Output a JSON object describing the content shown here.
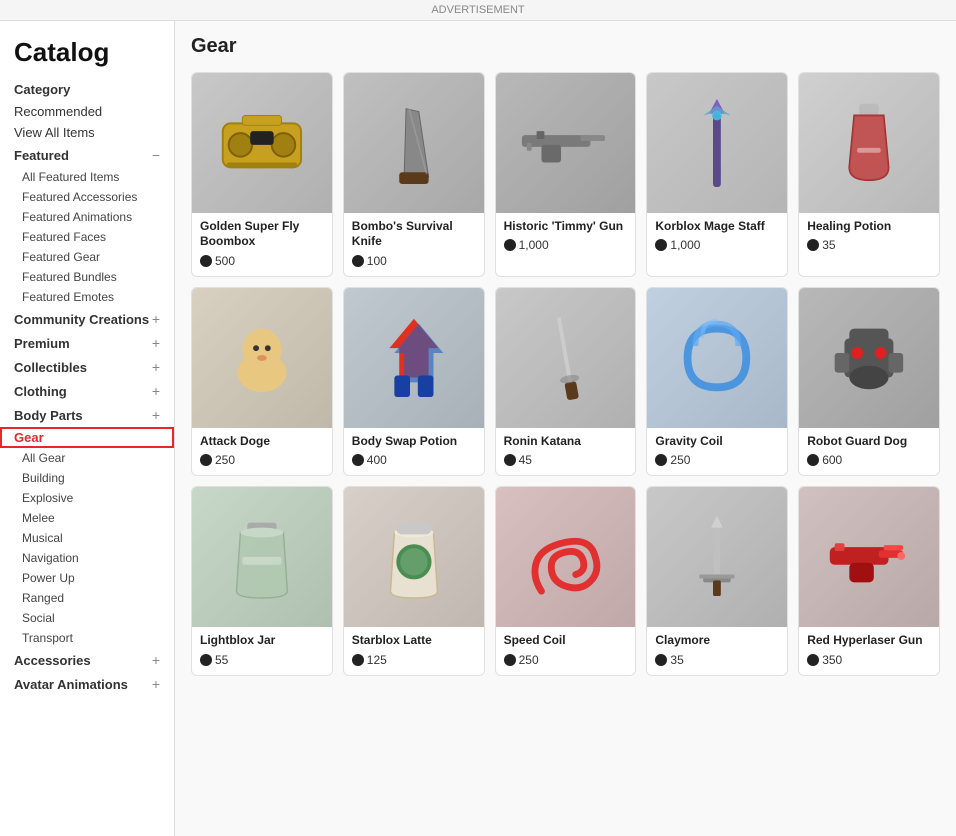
{
  "page": {
    "ad_label": "ADVERTISEMENT",
    "sidebar_title": "Catalog"
  },
  "sidebar": {
    "category_label": "Category",
    "items": [
      {
        "id": "recommended",
        "label": "Recommended",
        "level": "top",
        "active": false
      },
      {
        "id": "view-all",
        "label": "View All Items",
        "level": "top",
        "active": false
      },
      {
        "id": "featured",
        "label": "Featured",
        "level": "section",
        "toggle": "−"
      },
      {
        "id": "all-featured",
        "label": "All Featured Items",
        "level": "sub",
        "active": false
      },
      {
        "id": "featured-accessories",
        "label": "Featured Accessories",
        "level": "sub",
        "active": false
      },
      {
        "id": "featured-animations",
        "label": "Featured Animations",
        "level": "sub",
        "active": false
      },
      {
        "id": "featured-faces",
        "label": "Featured Faces",
        "level": "sub",
        "active": false
      },
      {
        "id": "featured-gear",
        "label": "Featured Gear",
        "level": "sub",
        "active": false
      },
      {
        "id": "featured-bundles",
        "label": "Featured Bundles",
        "level": "sub",
        "active": false
      },
      {
        "id": "featured-emotes",
        "label": "Featured Emotes",
        "level": "sub",
        "active": false
      },
      {
        "id": "community-creations",
        "label": "Community Creations",
        "level": "section",
        "toggle": "+"
      },
      {
        "id": "premium",
        "label": "Premium",
        "level": "top-toggle",
        "toggle": "+"
      },
      {
        "id": "collectibles",
        "label": "Collectibles",
        "level": "top-toggle",
        "toggle": "+"
      },
      {
        "id": "clothing",
        "label": "Clothing",
        "level": "top-toggle",
        "toggle": "+"
      },
      {
        "id": "body-parts",
        "label": "Body Parts",
        "level": "top-toggle",
        "toggle": "+"
      },
      {
        "id": "gear",
        "label": "Gear",
        "level": "top-toggle",
        "toggle": "",
        "active": true
      },
      {
        "id": "all-gear",
        "label": "All Gear",
        "level": "sub",
        "active": false
      },
      {
        "id": "building",
        "label": "Building",
        "level": "sub",
        "active": false
      },
      {
        "id": "explosive",
        "label": "Explosive",
        "level": "sub",
        "active": false
      },
      {
        "id": "melee",
        "label": "Melee",
        "level": "sub",
        "active": false
      },
      {
        "id": "musical",
        "label": "Musical",
        "level": "sub",
        "active": false
      },
      {
        "id": "navigation",
        "label": "Navigation",
        "level": "sub",
        "active": false
      },
      {
        "id": "power-up",
        "label": "Power Up",
        "level": "sub",
        "active": false
      },
      {
        "id": "ranged",
        "label": "Ranged",
        "level": "sub",
        "active": false
      },
      {
        "id": "social",
        "label": "Social",
        "level": "sub",
        "active": false
      },
      {
        "id": "transport",
        "label": "Transport",
        "level": "sub",
        "active": false
      },
      {
        "id": "accessories",
        "label": "Accessories",
        "level": "top-toggle",
        "toggle": "+"
      },
      {
        "id": "avatar-animations",
        "label": "Avatar Animations",
        "level": "top-toggle",
        "toggle": "+"
      }
    ]
  },
  "content": {
    "section_title": "Gear",
    "items": [
      {
        "id": 1,
        "name": "Golden Super Fly Boombox",
        "price": 500,
        "thumb_class": "thumb-boombox",
        "shape": "boombox"
      },
      {
        "id": 2,
        "name": "Bombo's Survival Knife",
        "price": 100,
        "thumb_class": "thumb-knife",
        "shape": "knife"
      },
      {
        "id": 3,
        "name": "Historic 'Timmy' Gun",
        "price": 1000,
        "thumb_class": "thumb-gun",
        "shape": "rifle"
      },
      {
        "id": 4,
        "name": "Korblox Mage Staff",
        "price": 1000,
        "thumb_class": "thumb-staff",
        "shape": "staff"
      },
      {
        "id": 5,
        "name": "Healing Potion",
        "price": 35,
        "thumb_class": "thumb-potion",
        "shape": "potion"
      },
      {
        "id": 6,
        "name": "Attack Doge",
        "price": 250,
        "thumb_class": "thumb-doge",
        "shape": "doge"
      },
      {
        "id": 7,
        "name": "Body Swap Potion",
        "price": 400,
        "thumb_class": "thumb-bodyswap",
        "shape": "bodyswap"
      },
      {
        "id": 8,
        "name": "Ronin Katana",
        "price": 45,
        "thumb_class": "thumb-katana",
        "shape": "katana"
      },
      {
        "id": 9,
        "name": "Gravity Coil",
        "price": 250,
        "thumb_class": "thumb-gravity",
        "shape": "coilblue"
      },
      {
        "id": 10,
        "name": "Robot Guard Dog",
        "price": 600,
        "thumb_class": "thumb-robot",
        "shape": "robot"
      },
      {
        "id": 11,
        "name": "Lightblox Jar",
        "price": 55,
        "thumb_class": "thumb-jar",
        "shape": "jar"
      },
      {
        "id": 12,
        "name": "Starblox Latte",
        "price": 125,
        "thumb_class": "thumb-latte",
        "shape": "latte"
      },
      {
        "id": 13,
        "name": "Speed Coil",
        "price": 250,
        "thumb_class": "thumb-coil",
        "shape": "coilred"
      },
      {
        "id": 14,
        "name": "Claymore",
        "price": 35,
        "thumb_class": "thumb-claymore",
        "shape": "claymore"
      },
      {
        "id": 15,
        "name": "Red Hyperlaser Gun",
        "price": 350,
        "thumb_class": "thumb-laser",
        "shape": "lasgun"
      }
    ]
  }
}
